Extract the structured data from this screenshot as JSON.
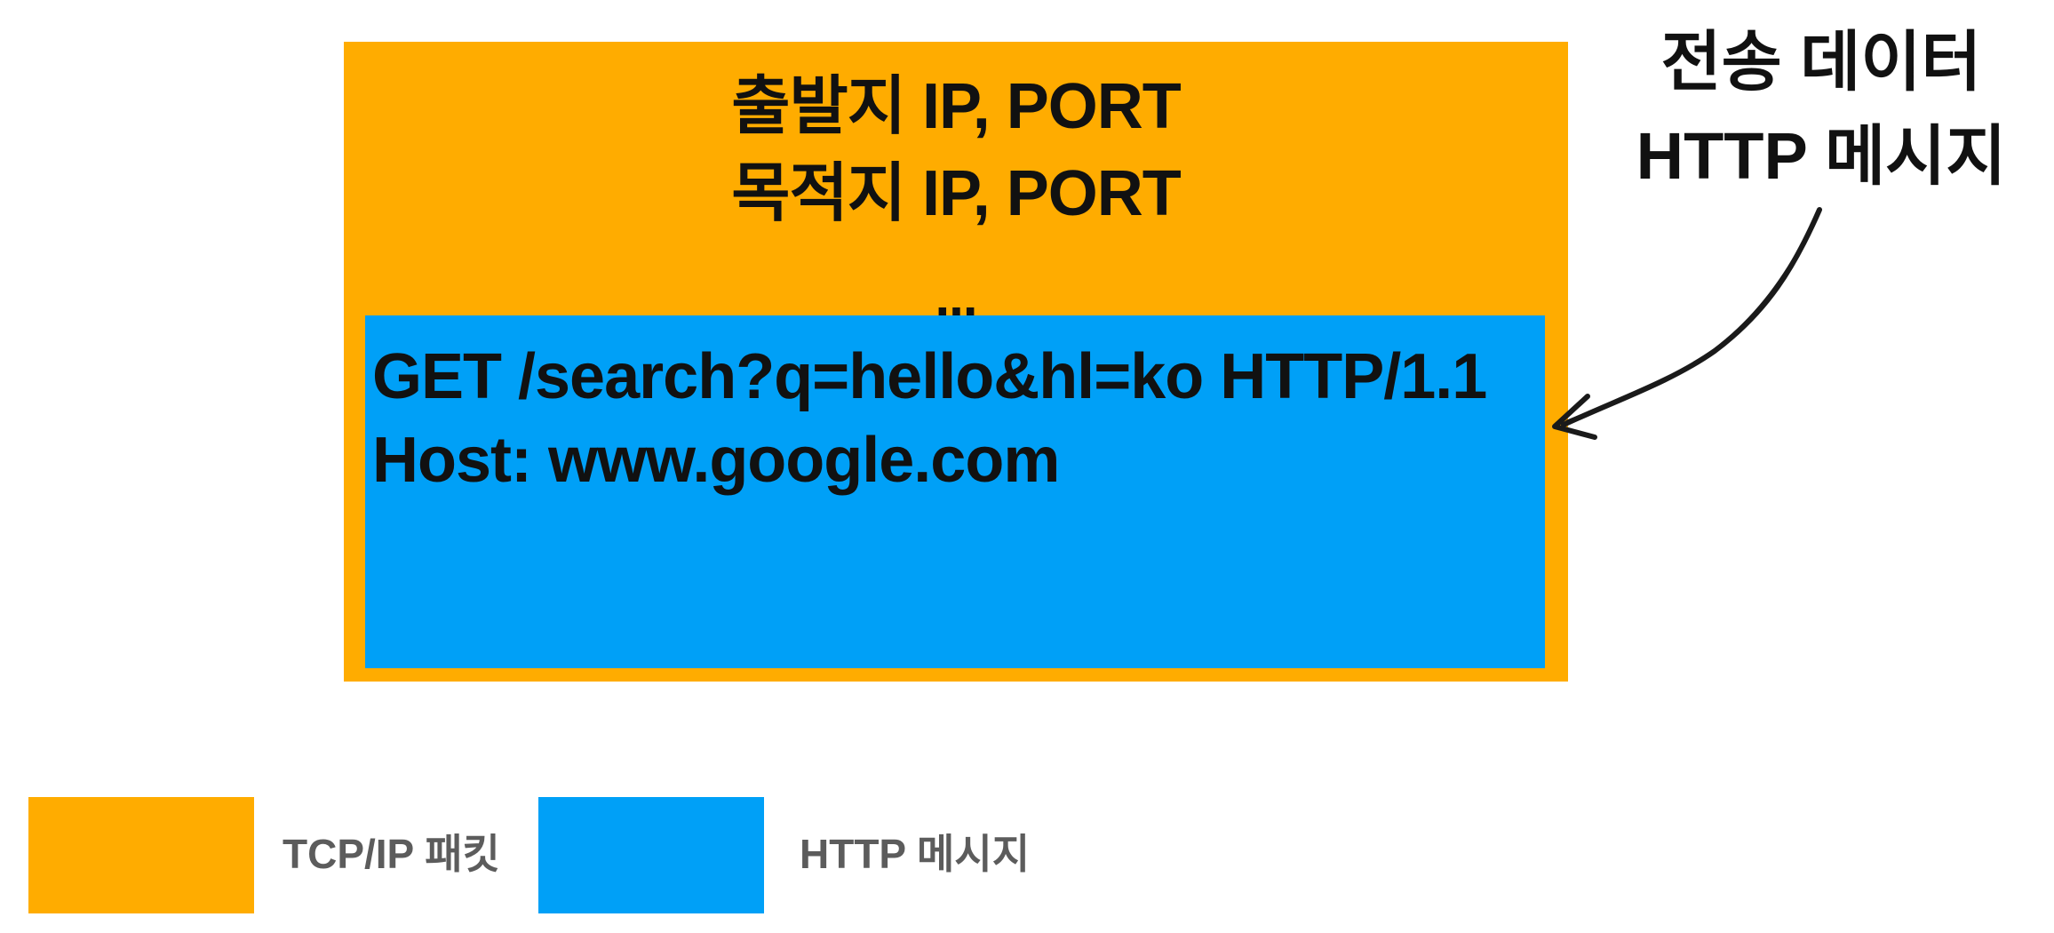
{
  "packet": {
    "header_lines": [
      "출발지 IP, PORT",
      "목적지 IP, PORT",
      "..."
    ],
    "message_lines": [
      "GET /search?q=hello&hl=ko HTTP/1.1",
      "Host: www.google.com"
    ]
  },
  "callout": {
    "lines": [
      "전송 데이터",
      "HTTP 메시지"
    ]
  },
  "legend": {
    "items": [
      {
        "label": "TCP/IP 패킷",
        "color": "#FFAC00"
      },
      {
        "label": "HTTP 메시지",
        "color": "#00A0F7"
      }
    ]
  },
  "colors": {
    "packet": "#FFAC00",
    "message": "#00A0F7",
    "text": "#111111",
    "legend_text": "#5c5c5c"
  }
}
